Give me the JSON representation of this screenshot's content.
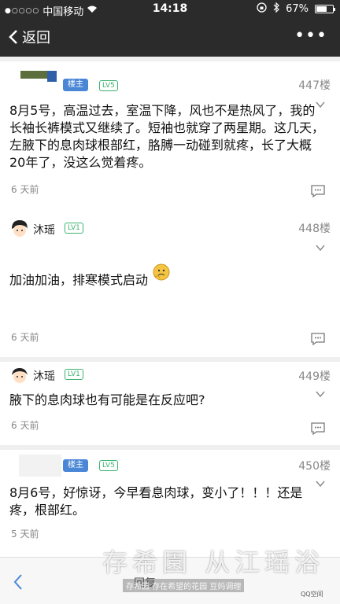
{
  "statusbar": {
    "carrier": "中国移动",
    "time": "14:18",
    "battery": "67%",
    "battery_level": 0.67
  },
  "navbar": {
    "back_label": "返回",
    "more_label": "•••"
  },
  "posts": [
    {
      "badge_host": "楼主",
      "level": "LV5",
      "floor": "447楼",
      "content": "8月5号，高温过去，室温下降，风也不是热风了，我的长袖长裤模式又继续了。短袖也就穿了两星期。这几天，左腋下的息肉球根部红，胳膊一动碰到就疼，长了大概20年了，没这么觉着疼。",
      "time": "6 天前"
    },
    {
      "username": "沐瑶",
      "level": "LV1",
      "floor": "448楼",
      "content": "加油加油，排寒模式启动",
      "time": "6 天前"
    },
    {
      "username": "沐瑶",
      "level": "LV1",
      "floor": "449楼",
      "content": "腋下的息肉球也有可能是在反应吧?",
      "time": "6 天前"
    },
    {
      "badge_host": "楼主",
      "level": "LV5",
      "floor": "450楼",
      "content": "8月6号，好惊讶，今早看息肉球，变小了！！！还是疼，根部红。",
      "time": "5 天前"
    }
  ],
  "bottombar": {
    "reply_label": "回复"
  },
  "watermark": {
    "main": "存希園 从江瑶浴",
    "sub": "存希园 存在希望的花园 豆妈调理",
    "corner": "QQ空间"
  }
}
